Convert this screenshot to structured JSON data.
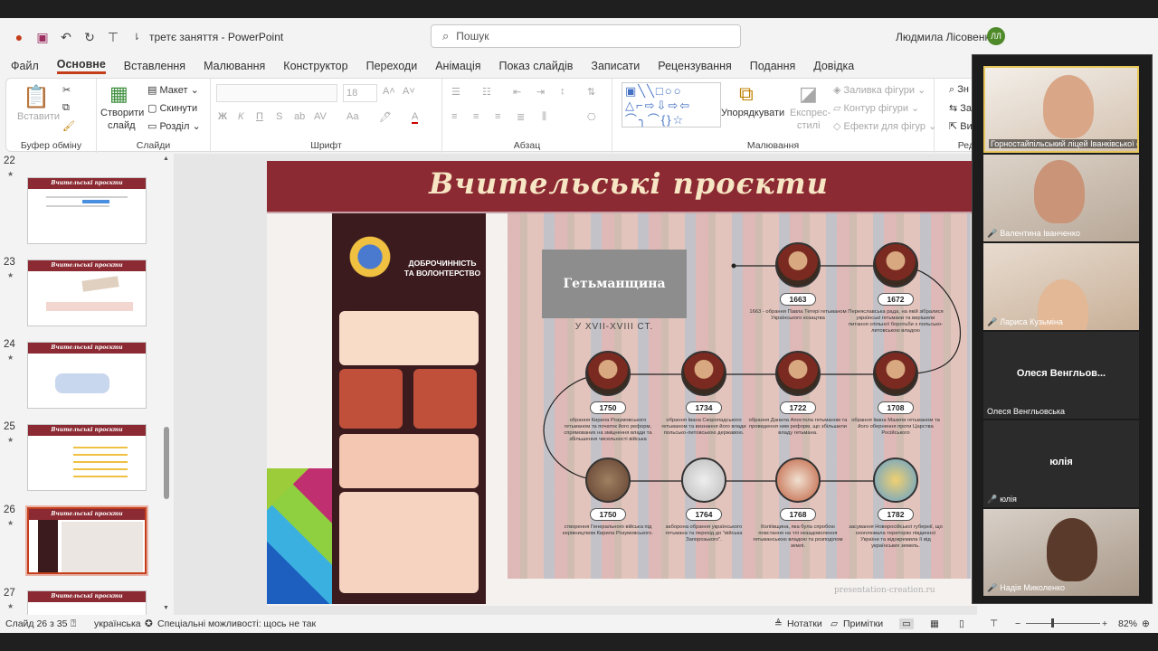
{
  "window": {
    "doc_title": "третє заняття  -  PowerPoint",
    "search_placeholder": "Пошук",
    "user_name": "Людмила Лісовенко",
    "user_initials": "ЛЛ"
  },
  "menu": [
    "Файл",
    "Основне",
    "Вставлення",
    "Малювання",
    "Конструктор",
    "Переходи",
    "Анімація",
    "Показ слайдів",
    "Записати",
    "Рецензування",
    "Подання",
    "Довідка"
  ],
  "ribbon": {
    "paste": "Вставити",
    "clipboard_group": "Буфер обміну",
    "new_slide": "Створити",
    "new_slide_2": "слайд",
    "layout": "Макет",
    "reset": "Скинути",
    "section": "Розділ",
    "slides_group": "Слайди",
    "font_size": "18",
    "font_group": "Шрифт",
    "paragraph_group": "Абзац",
    "arrange": "Упорядкувати",
    "quick_styles": "Експрес-",
    "quick_styles_2": "стилі",
    "shape_fill": "Заливка фігури",
    "shape_outline": "Контур фігури",
    "shape_effects": "Ефекти для фігур",
    "drawing_group": "Малювання",
    "find": "Зн",
    "replace": "За",
    "select": "Ви",
    "editing_group": "Ред"
  },
  "thumbnails": [
    {
      "num": "22",
      "title": "Вчительські проєкти"
    },
    {
      "num": "23",
      "title": "Вчительські проєкти"
    },
    {
      "num": "24",
      "title": "Вчительські проєкти"
    },
    {
      "num": "25",
      "title": "Вчительські проєкти"
    },
    {
      "num": "26",
      "title": "Вчительські проєкти"
    },
    {
      "num": "27",
      "title": "Вчительські проєкти"
    }
  ],
  "slide": {
    "title": "Вчительські проєкти",
    "poster_title": "ДОБРОЧИННІСТЬ ТА ВОЛОНТЕРСТВО",
    "timeline_heading": "Гетьманщина",
    "timeline_sub": "У XVII-XVIII СТ.",
    "events": [
      {
        "year": "1663",
        "text": "1663 - обрання Павла Тетері гетьманом Українського козацтва"
      },
      {
        "year": "1672",
        "text": "Переяславська рада, на якій зібралися українські гетьмани та вирішили питання спільної боротьби з польсько-литовською владою"
      },
      {
        "year": "1750",
        "text": "обрання Кирила Розумовського гетьманом та початок його реформ, спрямованих на зміцнення влади та збільшення чисельності війська"
      },
      {
        "year": "1734",
        "text": "обрання Івана Скоропадського гетьманом та визнання його влади польсько-литовською державою."
      },
      {
        "year": "1722",
        "text": "обрання Данила Апостола гетьманом та проведення ним реформ, що збільшили владу гетьмана."
      },
      {
        "year": "1708",
        "text": "обрання Івана Мазепи гетьманом та його обернення проти Царства Російського"
      },
      {
        "year": "1750",
        "text": "створення Генерального війська під керівництвом Кирила Розумовського."
      },
      {
        "year": "1764",
        "text": "заборона обрання українського гетьмана та перехід до \"війська Запорозького\"."
      },
      {
        "year": "1768",
        "text": "Коліївщина, яка була спробою повстання на тлі незадоволення гетьманською владою та розподілом землі."
      },
      {
        "year": "1782",
        "text": "засування Новоросійської губернії, що охоплювала територію південної України та відокремила її від українських земель."
      }
    ],
    "watermark": "presentation-creation.ru"
  },
  "participants": [
    {
      "name": "Горностайпільський ліцей Іванківської с..."
    },
    {
      "name": "Валентина Іванченко"
    },
    {
      "name": "Лариса Кузьміна"
    },
    {
      "name": "Олеся Венгльовська",
      "center": "Олеся  Венгльов..."
    },
    {
      "name": "юлія",
      "center": "юлія"
    },
    {
      "name": "Надія Миколенко"
    }
  ],
  "status": {
    "slide_info": "Слайд 26 з 35",
    "language": "українська",
    "accessibility": "Спеціальні можливості: щось не так",
    "notes": "Нотатки",
    "comments": "Примітки",
    "zoom": "82%"
  }
}
